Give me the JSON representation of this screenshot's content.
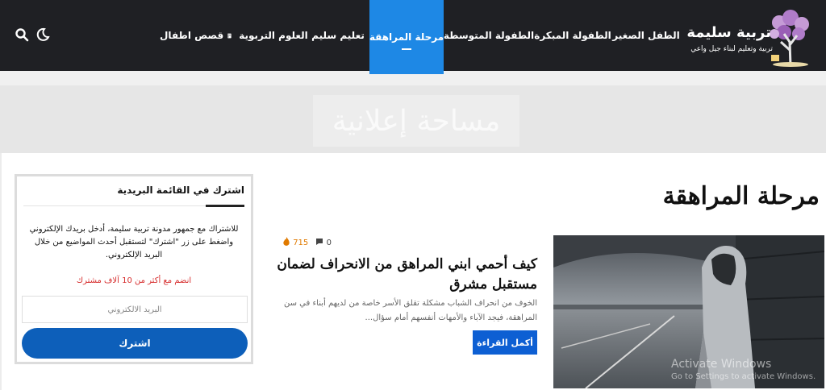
{
  "brand": {
    "title": "تربية سليمة",
    "subtitle": "تربية وتعليم لبناء جيل واعي"
  },
  "nav": {
    "items": [
      {
        "label": "الطفل الصغير"
      },
      {
        "label": "الطفولة المبكرة"
      },
      {
        "label": "الطفولة المتوسطة"
      },
      {
        "label": "مرحلة المراهقة"
      },
      {
        "label": "تعليم سليم"
      },
      {
        "label": "العلوم التربوية"
      },
      {
        "label": "قصص اطفال"
      }
    ]
  },
  "ad": {
    "label": "مساحة إعلانية"
  },
  "page": {
    "title": "مرحلة المراهقة"
  },
  "post": {
    "comments": "0",
    "views": "715",
    "title": "كيف أحمي ابني المراهق من الانحراف لضمان مستقبل مشرق",
    "excerpt": "الخوف من انحراف الشباب مشكلة تقلق الأسر خاصة من لديهم أبناء في سن المراهقة، فيجد الآباء والأمهات أنفسهم أمام سؤال...",
    "read_more": "أكمل القراءة"
  },
  "newsletter": {
    "title": "اشترك في القائمة البريدية",
    "description": "للاشتراك مع جمهور مدونة تربية سليمة، أدخل بريدك الإلكتروني واضغط على زر \"اشترك\" لتستقبل أحدث المواضيع من خلال البريد الإلكتروني.",
    "join": "انضم مع أكثر من 10 آلاف مشترك",
    "email_placeholder": "البريد الالكتروني",
    "subscribe": "اشترك"
  },
  "watermark": {
    "line1": "Activate Windows",
    "line2": "Go to Settings to activate Windows."
  },
  "colors": {
    "nav_bg": "#1f2024",
    "accent": "#1e88e5",
    "button": "#0d5fd3",
    "views": "#e07a00",
    "join": "#d62c2c"
  }
}
